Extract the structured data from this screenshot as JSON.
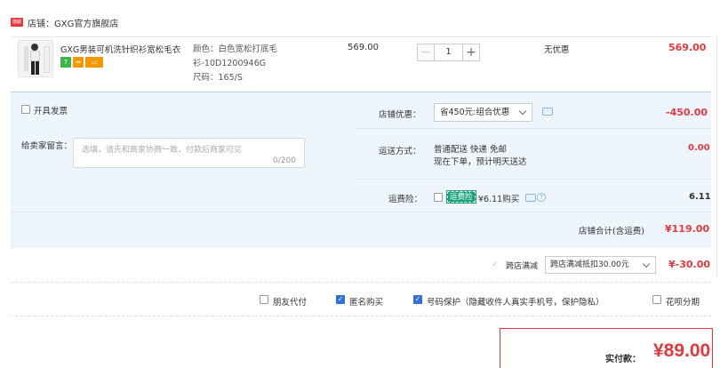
{
  "shop": {
    "badge": "旗舰",
    "name": "店铺：GXG官方旗舰店"
  },
  "item": {
    "title": "GXG男装可机洗针织衫宽松毛衣",
    "tags": [
      "7",
      "⇔",
      "▭"
    ],
    "sku_color": "颜色：白色宽松打底毛衫-10D1200946G",
    "sku_size": "尺码：165/S",
    "price": "569.00",
    "quantity": "1",
    "minus": "−",
    "plus": "+",
    "discount": "无优惠",
    "subtotal": "569.00"
  },
  "invoice": {
    "label": "开具发票"
  },
  "message": {
    "label": "给卖家留言：",
    "placeholder": "选填，请先和商家协商一致，付款后商家可见",
    "count": "0/200"
  },
  "shop_discount": {
    "label": "店铺优惠：",
    "selected": "省450元:组合优惠",
    "amount": "-450.00"
  },
  "shipping": {
    "label": "运送方式：",
    "line1": "普通配送 快递 免邮",
    "line2": "现在下单，预计明天送达",
    "amount": "0.00"
  },
  "insurance": {
    "label": "运费险：",
    "badge": "运费险",
    "price": "¥6.11购买",
    "help": "?",
    "amount": "6.11"
  },
  "shop_total": {
    "label": "店铺合计(含运费)",
    "amount": "¥119.00"
  },
  "cross_shop": {
    "check": "✓",
    "label": "跨店满减",
    "selected": "跨店满减抵扣30.00元",
    "amount": "¥-30.00"
  },
  "options": {
    "friend_pay": "朋友代付",
    "anonymous": "匿名购买",
    "privacy": "号码保护（隐藏收件人真实手机号，保护隐私）",
    "public": "花呗分期"
  },
  "payment": {
    "label": "实付款：",
    "amount": "¥89.00"
  },
  "colors": {
    "accent_red": "#e4393c",
    "panel_blue": "#eef5fd",
    "check_blue": "#2e6fd9",
    "insurance_green": "#1aa27b"
  }
}
